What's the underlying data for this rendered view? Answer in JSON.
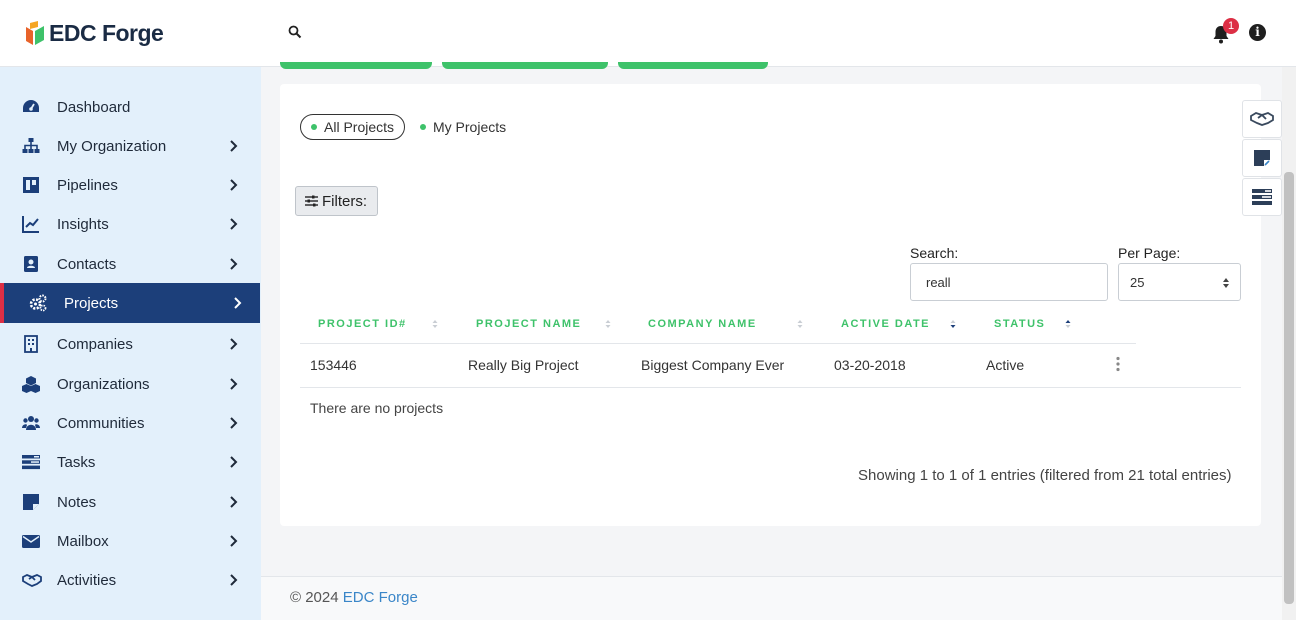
{
  "header": {
    "logo_text": "EDC Forge",
    "notification_count": "1",
    "info_glyph": "i"
  },
  "sidebar": {
    "items": [
      {
        "label": "Dashboard",
        "icon": "dashboard-icon",
        "has_chevron": false
      },
      {
        "label": "My Organization",
        "icon": "org-chart-icon",
        "has_chevron": true
      },
      {
        "label": "Pipelines",
        "icon": "pipeline-board-icon",
        "has_chevron": true
      },
      {
        "label": "Insights",
        "icon": "line-chart-icon",
        "has_chevron": true
      },
      {
        "label": "Contacts",
        "icon": "contact-card-icon",
        "has_chevron": true
      },
      {
        "label": "Projects",
        "icon": "gears-icon",
        "has_chevron": true,
        "active": true
      },
      {
        "label": "Companies",
        "icon": "building-icon",
        "has_chevron": true
      },
      {
        "label": "Organizations",
        "icon": "cubes-icon",
        "has_chevron": true
      },
      {
        "label": "Communities",
        "icon": "users-icon",
        "has_chevron": true
      },
      {
        "label": "Tasks",
        "icon": "tasks-icon",
        "has_chevron": true
      },
      {
        "label": "Notes",
        "icon": "note-icon",
        "has_chevron": true
      },
      {
        "label": "Mailbox",
        "icon": "envelope-icon",
        "has_chevron": true
      },
      {
        "label": "Activities",
        "icon": "handshake-icon",
        "has_chevron": true
      }
    ]
  },
  "main": {
    "scope_tabs": [
      {
        "label": "All Projects",
        "active": true
      },
      {
        "label": "My Projects",
        "active": false
      }
    ],
    "filters_label": "Filters:",
    "search": {
      "label": "Search:",
      "value": "reall"
    },
    "per_page": {
      "label": "Per Page:",
      "value": "25"
    },
    "table": {
      "columns": [
        "PROJECT ID#",
        "PROJECT NAME",
        "COMPANY NAME",
        "ACTIVE DATE",
        "STATUS"
      ],
      "rows": [
        {
          "id": "153446",
          "name": "Really Big Project",
          "company": "Biggest Company Ever",
          "date": "03-20-2018",
          "status": "Active"
        }
      ],
      "empty_text": "There are no projects",
      "summary": "Showing 1 to 1 of 1 entries (filtered from 21 total entries)"
    }
  },
  "footer": {
    "copyright": "© 2024 ",
    "brand_link": "EDC Forge"
  },
  "colors": {
    "accent_green": "#3ec26a",
    "nav_active": "#1c3f7a",
    "active_marker": "#dc2f45",
    "link": "#3a86c8"
  }
}
